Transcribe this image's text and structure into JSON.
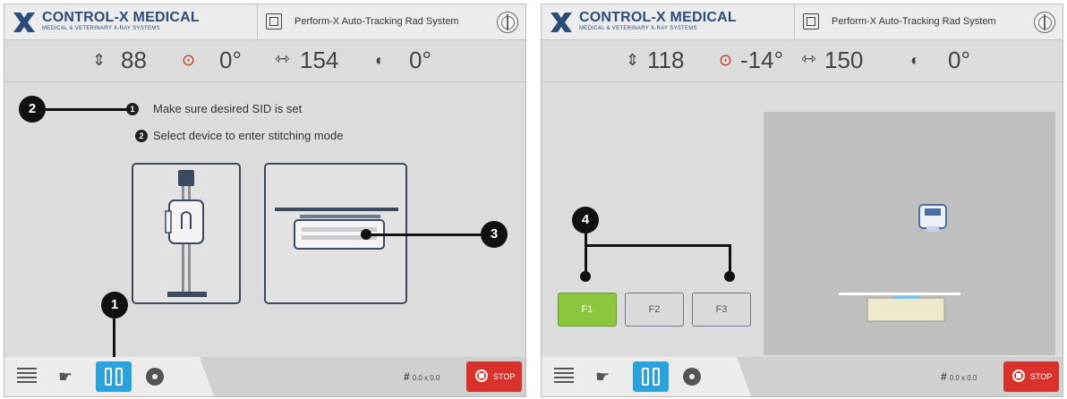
{
  "brand": {
    "name": "CONTROL-X MEDICAL",
    "tagline": "MEDICAL & VETERINARY X-RAY SYSTEMS",
    "colors": {
      "brand": "#2c4d79",
      "accent": "#2aa3dc",
      "active_f": "#8cc63e",
      "stop": "#d9322c"
    }
  },
  "system_title": "Perform-X Auto-Tracking Rad System",
  "left": {
    "readouts": [
      {
        "icon": "vertical-travel-icon",
        "value": "88"
      },
      {
        "icon": "tube-angle-icon",
        "value": "0°"
      },
      {
        "icon": "sid-icon",
        "value": "154"
      },
      {
        "icon": "collimator-rotation-icon",
        "value": "0°"
      }
    ],
    "instructions": [
      {
        "step": "1",
        "text": "Make sure desired SID is set"
      },
      {
        "step": "2",
        "text": "Select device to enter stitching mode"
      }
    ],
    "callouts": [
      "1",
      "2",
      "3"
    ],
    "devices": [
      "wall-stand",
      "table-bucky"
    ]
  },
  "right": {
    "readouts": [
      {
        "icon": "vertical-travel-icon",
        "value": "118"
      },
      {
        "icon": "tube-angle-icon",
        "value": "-14°"
      },
      {
        "icon": "sid-icon",
        "value": "150"
      },
      {
        "icon": "collimator-rotation-icon",
        "value": "0°"
      }
    ],
    "callouts": [
      "4"
    ],
    "field_buttons": [
      "F1",
      "F2",
      "F3"
    ],
    "active_field": "F1"
  },
  "footer": {
    "coordinates": "0.0 x 0.0",
    "stop_label": "STOP"
  }
}
